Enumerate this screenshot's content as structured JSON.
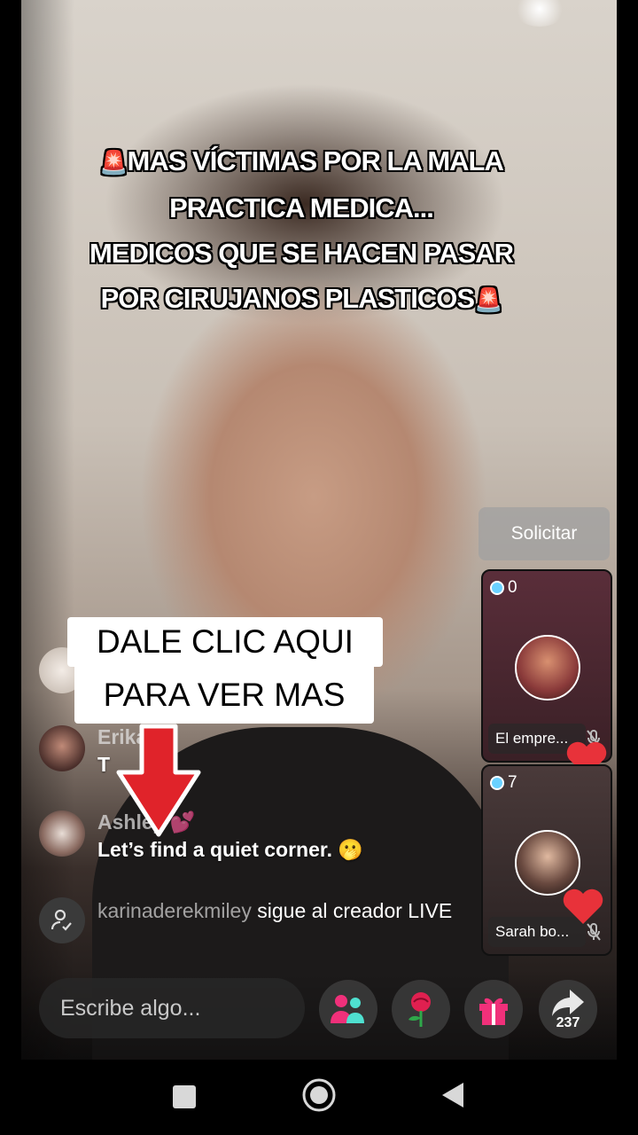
{
  "overlay": {
    "headline_line1": "MAS VÍCTIMAS POR LA MALA",
    "headline_line2": "PRACTICA MEDICA...",
    "headline_line3": "MEDICOS QUE SE HACEN PASAR",
    "headline_line4": "POR CIRUJANOS PLASTICOS",
    "siren_emoji": "🚨",
    "cta_line1": "DALE CLIC AQUI",
    "cta_line2": "PARA VER MAS"
  },
  "request_button": {
    "label": "Solicitar"
  },
  "guests": [
    {
      "count": "0",
      "name": "El empre..."
    },
    {
      "count": "7",
      "name": "Sarah bo..."
    }
  ],
  "comments": [
    {
      "user": "Erika",
      "text": "T",
      "emoji": "😊"
    },
    {
      "user": "Ashley",
      "text": "Let’s find a quiet corner.",
      "emoji": "🫢",
      "user_emoji": "💕"
    }
  ],
  "system_message": {
    "user": "karinaderekmiley",
    "text": "sigue al creador LIVE"
  },
  "composer": {
    "placeholder": "Escribe algo..."
  },
  "actions": {
    "share_count": "237"
  },
  "colors": {
    "accent_pink": "#f0307a",
    "heart_red": "#e8323a",
    "badge_blue": "#6ad1ff"
  }
}
